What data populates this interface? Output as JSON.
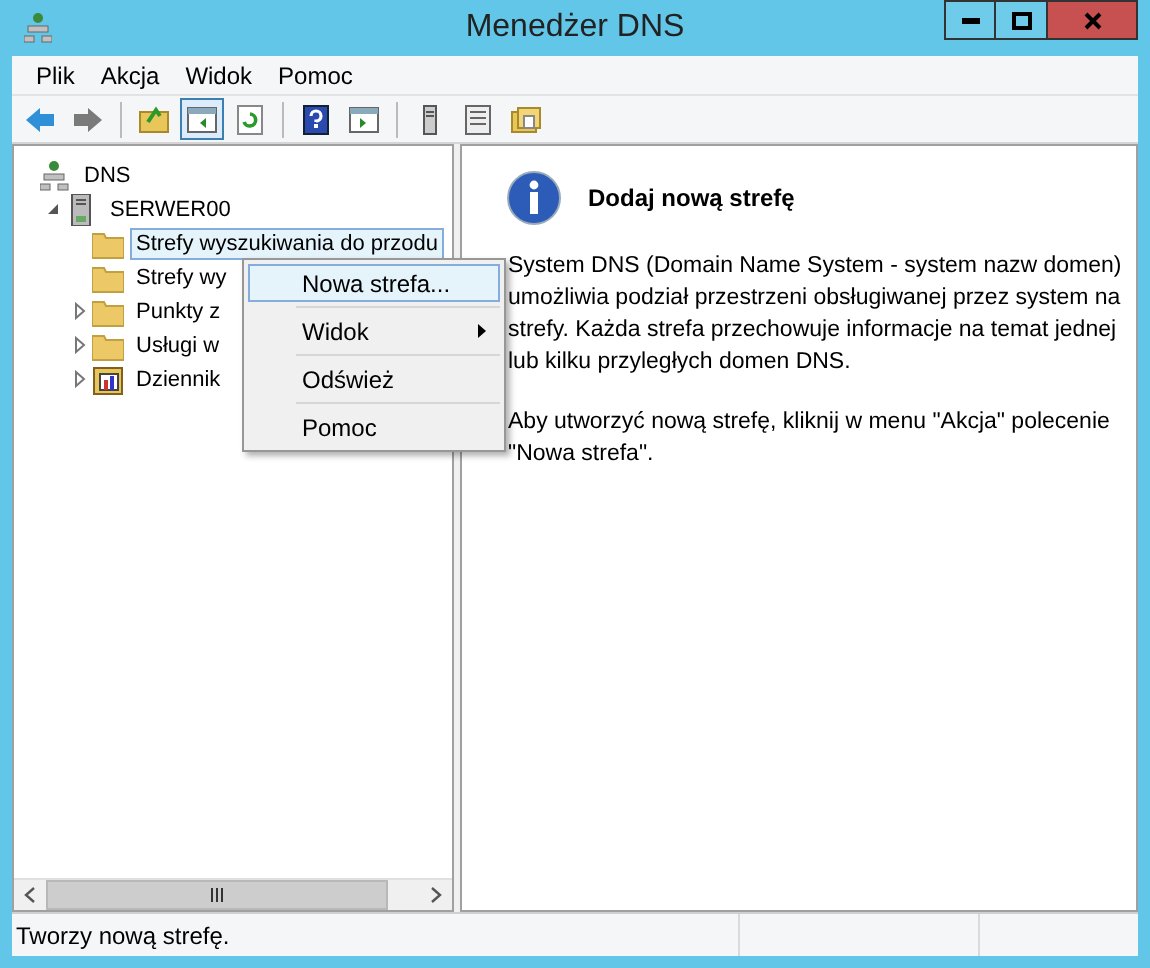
{
  "window": {
    "title": "Menedżer DNS"
  },
  "menu_bar": [
    {
      "label": "Plik"
    },
    {
      "label": "Akcja"
    },
    {
      "label": "Widok"
    },
    {
      "label": "Pomoc"
    }
  ],
  "toolbar": [
    {
      "kind": "back",
      "pressed": false
    },
    {
      "kind": "forward",
      "pressed": false
    },
    {
      "kind": "separator"
    },
    {
      "kind": "up",
      "pressed": false
    },
    {
      "kind": "tree",
      "pressed": true
    },
    {
      "kind": "refresh",
      "pressed": false
    },
    {
      "kind": "separator"
    },
    {
      "kind": "help",
      "pressed": false
    },
    {
      "kind": "pane",
      "pressed": false
    },
    {
      "kind": "separator"
    },
    {
      "kind": "server",
      "pressed": false
    },
    {
      "kind": "list",
      "pressed": false
    },
    {
      "kind": "folders",
      "pressed": false
    }
  ],
  "tree": {
    "label": "DNS",
    "kind": "root",
    "children": [
      {
        "label": "SERWER00",
        "kind": "server",
        "expanded": true,
        "children": [
          {
            "label": "Strefy wyszukiwania do przodu",
            "kind": "folder",
            "selected": true
          },
          {
            "label": "Strefy wy",
            "kind": "folder",
            "selected": false
          },
          {
            "label": "Punkty z",
            "kind": "folder",
            "selected": false,
            "expanded": false
          },
          {
            "label": "Usługi w",
            "kind": "folder",
            "selected": false,
            "expanded": false
          },
          {
            "label": "Dziennik",
            "kind": "log",
            "selected": false,
            "expanded": false
          }
        ]
      }
    ]
  },
  "context_menu": [
    {
      "label": "Nowa strefa...",
      "selected": true,
      "submenu": false
    },
    {
      "label": "Widok",
      "selected": false,
      "submenu": true
    },
    {
      "label": "Odśwież",
      "selected": false,
      "submenu": false
    },
    {
      "label": "Pomoc",
      "selected": false,
      "submenu": false
    }
  ],
  "details": {
    "title": "Dodaj nową strefę",
    "paragraphs": [
      "System DNS (Domain Name System - system nazw domen) umożliwia podział przestrzeni obsługiwanej przez system na strefy. Każda strefa przechowuje informacje na temat jednej lub kilku przyległych domen DNS.",
      "Aby utworzyć nową strefę, kliknij w menu \"Akcja\" polecenie \"Nowa strefa\"."
    ]
  },
  "status_bar": {
    "text": "Tworzy nową strefę."
  }
}
